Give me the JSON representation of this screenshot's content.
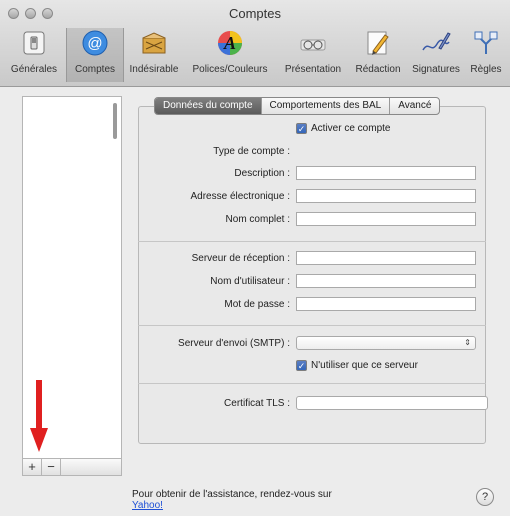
{
  "window": {
    "title": "Comptes"
  },
  "toolbar": {
    "items": [
      {
        "label": "Générales",
        "icon": "general-switch-icon"
      },
      {
        "label": "Comptes",
        "icon": "at-sign-icon"
      },
      {
        "label": "Indésirable",
        "icon": "junk-mail-icon"
      },
      {
        "label": "Polices/Couleurs",
        "icon": "fonts-colors-icon"
      },
      {
        "label": "Présentation",
        "icon": "glasses-icon"
      },
      {
        "label": "Rédaction",
        "icon": "compose-pencil-icon"
      },
      {
        "label": "Signatures",
        "icon": "signature-pen-icon"
      },
      {
        "label": "Règles",
        "icon": "rules-icon"
      }
    ],
    "selected": "Comptes"
  },
  "tabs": [
    {
      "label": "Données du compte",
      "active": true
    },
    {
      "label": "Comportements des BAL",
      "active": false
    },
    {
      "label": "Avancé",
      "active": false
    }
  ],
  "form": {
    "activate_label": "Activer ce compte",
    "account_type_label": "Type de compte :",
    "description_label": "Description :",
    "email_label": "Adresse électronique :",
    "fullname_label": "Nom complet :",
    "incoming_server_label": "Serveur de réception :",
    "username_label": "Nom d'utilisateur :",
    "password_label": "Mot de passe :",
    "smtp_label": "Serveur d'envoi (SMTP) :",
    "smtp_selected": "",
    "only_this_server_label": "N'utiliser que ce serveur",
    "tls_label": "Certificat TLS :"
  },
  "sidebar": {
    "add_label": "+",
    "remove_label": "−"
  },
  "footer": {
    "help_text": "Pour obtenir de l'assistance, rendez-vous sur",
    "link_text": "Yahoo!",
    "help_button": "?"
  },
  "colors": {
    "accent": "#3466b9",
    "arrow": "#e02020",
    "link": "#1d4fd6"
  }
}
